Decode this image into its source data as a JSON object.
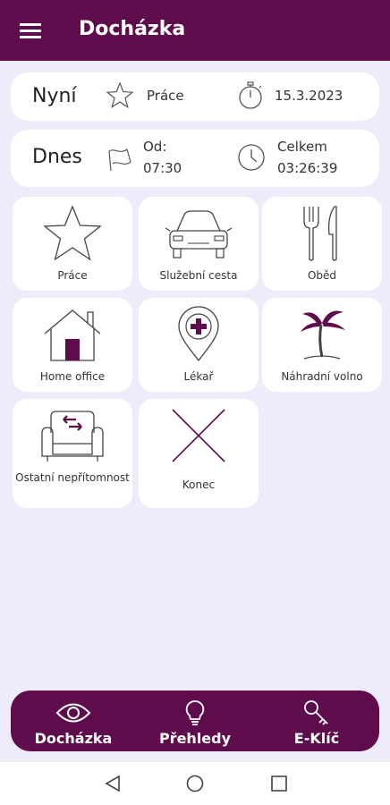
{
  "appbar": {
    "title": "Docházka",
    "menu_icon": "hamburger-menu-icon"
  },
  "now_card": {
    "label": "Nyní",
    "status_icon": "star-icon",
    "status": "Práce",
    "date_icon": "stopwatch-icon",
    "date": "15.3.2023"
  },
  "today_card": {
    "label": "Dnes",
    "from_icon": "flag-icon",
    "from_label": "Od:",
    "from_time": "07:30",
    "total_icon": "clock-icon",
    "total_label": "Celkem",
    "total_time": "03:26:39"
  },
  "tiles": [
    {
      "label": "Práce",
      "icon": "star-icon"
    },
    {
      "label": "Služební cesta",
      "icon": "car-icon"
    },
    {
      "label": "Oběd",
      "icon": "fork-knife-icon"
    },
    {
      "label": "Home office",
      "icon": "house-icon"
    },
    {
      "label": "Lékař",
      "icon": "medical-pin-icon"
    },
    {
      "label": "Náhradní volno",
      "icon": "palm-tree-icon"
    },
    {
      "label": "Ostatní nepřítomnost",
      "icon": "armchair-icon"
    },
    {
      "label": "Konec",
      "icon": "cross-icon"
    }
  ],
  "bottom_nav": [
    {
      "label": "Docházka",
      "icon": "eye-icon"
    },
    {
      "label": "Přehledy",
      "icon": "lightbulb-icon"
    },
    {
      "label": "E-Klíč",
      "icon": "key-icon"
    }
  ],
  "system_nav": {
    "back_icon": "back-triangle-icon",
    "home_icon": "home-circle-icon",
    "recents_icon": "recents-square-icon"
  },
  "colors": {
    "primary": "#5e0c4b",
    "background": "#eeebfb",
    "card": "#ffffff"
  }
}
